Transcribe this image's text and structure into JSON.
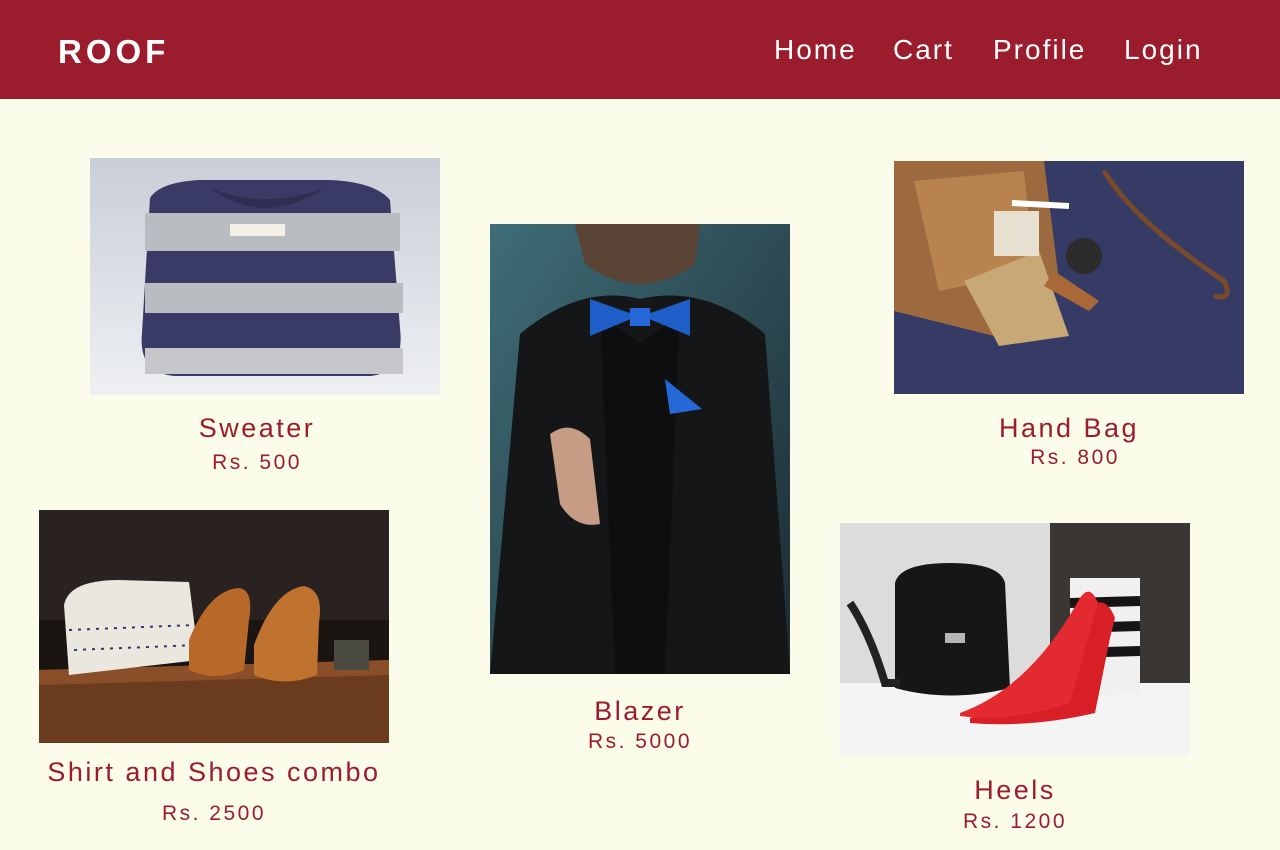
{
  "header": {
    "brand": "ROOF",
    "nav": {
      "home": "Home",
      "cart": "Cart",
      "profile": "Profile",
      "login": "Login"
    }
  },
  "colors": {
    "accent": "#9b1c2c",
    "background": "#fcfcea",
    "nav_text": "#ffffff"
  },
  "products": [
    {
      "name": "Sweater",
      "price": "Rs. 500",
      "image": "sweater-photo"
    },
    {
      "name": "Blazer",
      "price": "Rs. 5000",
      "image": "blazer-photo"
    },
    {
      "name": "Hand Bag",
      "price": "Rs. 800",
      "image": "handbag-photo"
    },
    {
      "name": "Shirt and Shoes combo",
      "price": "Rs. 2500",
      "image": "shirt-shoes-photo"
    },
    {
      "name": "Heels",
      "price": "Rs. 1200",
      "image": "heels-photo"
    }
  ]
}
